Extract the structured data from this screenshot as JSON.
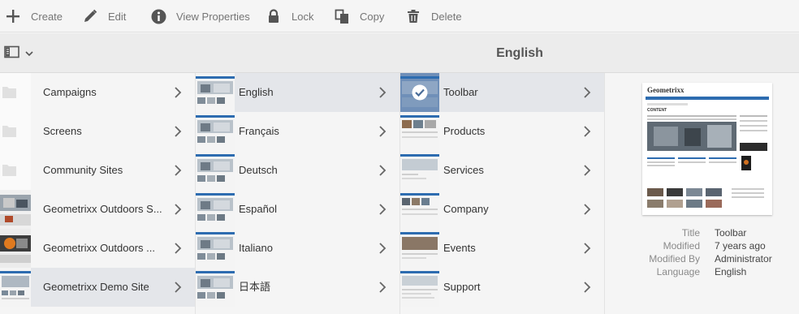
{
  "toolbar": {
    "create": "Create",
    "edit": "Edit",
    "view_properties": "View Properties",
    "lock": "Lock",
    "copy": "Copy",
    "delete": "Delete"
  },
  "header": {
    "title": "English"
  },
  "columns": [
    {
      "items": [
        {
          "label": "Campaigns",
          "thumb": "folder-icon"
        },
        {
          "label": "Screens",
          "thumb": "folder-icon"
        },
        {
          "label": "Community Sites",
          "thumb": "folder-icon"
        },
        {
          "label": "Geometrixx Outdoors S...",
          "thumb": "page"
        },
        {
          "label": "Geometrixx Outdoors ...",
          "thumb": "page"
        },
        {
          "label": "Geometrixx Demo Site",
          "thumb": "page"
        }
      ]
    },
    {
      "items": [
        {
          "label": "English"
        },
        {
          "label": "Français"
        },
        {
          "label": "Deutsch"
        },
        {
          "label": "Español"
        },
        {
          "label": "Italiano"
        },
        {
          "label": "日本語"
        }
      ]
    },
    {
      "items": [
        {
          "label": "Toolbar"
        },
        {
          "label": "Products"
        },
        {
          "label": "Services"
        },
        {
          "label": "Company"
        },
        {
          "label": "Events"
        },
        {
          "label": "Support"
        }
      ]
    }
  ],
  "preview": {
    "brand": "Geometrixx",
    "heading": "CONTENT",
    "meta": [
      {
        "key": "Title",
        "value": "Toolbar"
      },
      {
        "key": "Modified",
        "value": "7 years ago"
      },
      {
        "key": "Modified By",
        "value": "Administrator"
      },
      {
        "key": "Language",
        "value": "English"
      }
    ]
  },
  "colors": {
    "selected_row": "#e4e6ea",
    "accent_blue": "#2d6cb0",
    "icon_gray": "#6e6e6e"
  }
}
